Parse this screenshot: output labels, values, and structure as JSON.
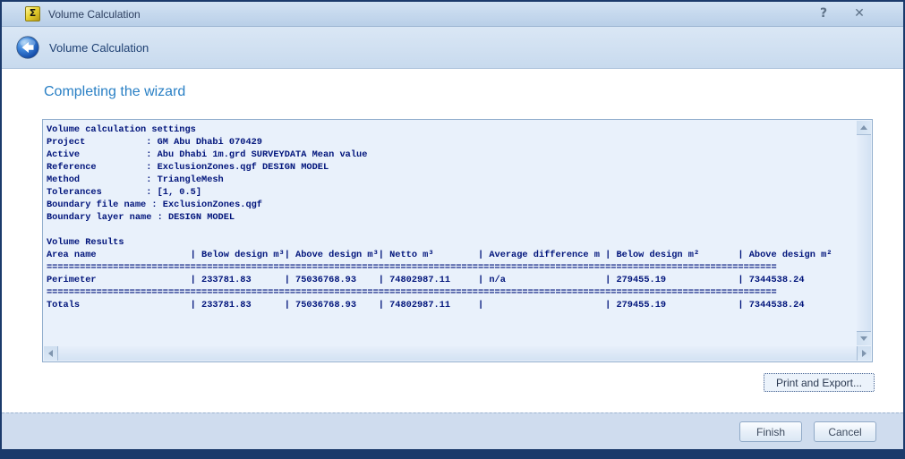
{
  "window": {
    "title": "Volume Calculation",
    "icon_glyph": "Σ",
    "help_glyph": "?",
    "close_glyph": "✕"
  },
  "header": {
    "title": "Volume Calculation"
  },
  "wizard": {
    "heading": "Completing the wizard"
  },
  "report": {
    "lines": [
      "Volume calculation settings",
      "Project           : GM Abu Dhabi 070429",
      "Active            : Abu Dhabi 1m.grd SURVEYDATA Mean value",
      "Reference         : ExclusionZones.qgf DESIGN MODEL",
      "Method            : TriangleMesh",
      "Tolerances        : [1, 0.5]",
      "Boundary file name : ExclusionZones.qgf",
      "Boundary layer name : DESIGN MODEL",
      "",
      "Volume Results",
      "Area name                 | Below design m³| Above design m³| Netto m³        | Average difference m | Below design m²       | Above design m²",
      "====================================================================================================================================",
      "Perimeter                 | 233781.83      | 75036768.93    | 74802987.11     | n/a                  | 279455.19             | 7344538.24",
      "====================================================================================================================================",
      "Totals                    | 233781.83      | 75036768.93    | 74802987.11     |                      | 279455.19             | 7344538.24"
    ]
  },
  "buttons": {
    "print_export": "Print and Export...",
    "finish": "Finish",
    "cancel": "Cancel"
  },
  "table": {
    "columns": [
      "Area name",
      "Below design m³",
      "Above design m³",
      "Netto m³",
      "Average difference m",
      "Below design m²",
      "Above design m²"
    ],
    "rows": [
      [
        "Perimeter",
        "233781.83",
        "75036768.93",
        "74802987.11",
        "n/a",
        "279455.19",
        "7344538.24"
      ],
      [
        "Totals",
        "233781.83",
        "75036768.93",
        "74802987.11",
        "",
        "279455.19",
        "7344538.24"
      ]
    ]
  },
  "colors": {
    "window_border": "#1b3a6b",
    "titlebar_bg": "#c3d6ec",
    "heading_blue": "#2a80c5",
    "report_bg": "#e9f1fb",
    "report_text": "#00147b",
    "footer_bg": "#cfdcee",
    "icon_gold": "#e8d232"
  }
}
